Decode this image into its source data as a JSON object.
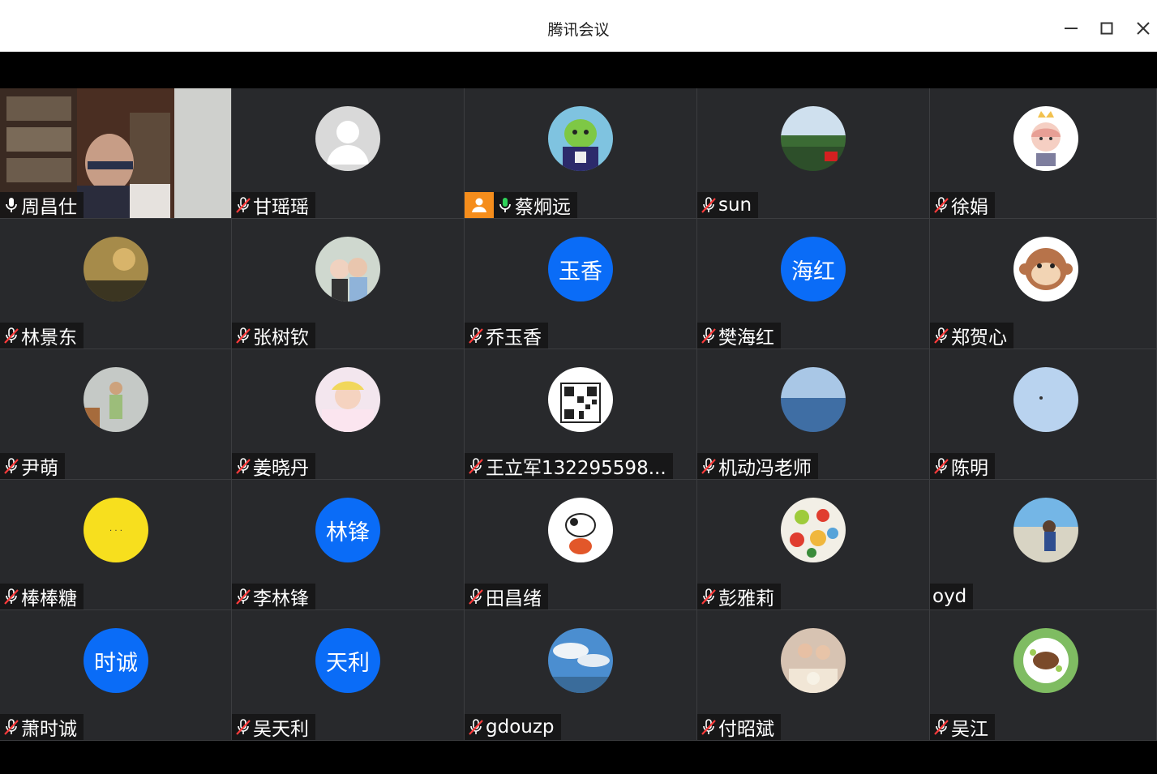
{
  "window": {
    "title": "腾讯会议",
    "buttons": {
      "minimize": "minimize",
      "maximize": "maximize",
      "close": "close"
    }
  },
  "participants": [
    {
      "name": "周昌仕",
      "mic": "on-white",
      "video": true
    },
    {
      "name": "甘瑶瑶",
      "mic": "muted",
      "avatar": "default-person"
    },
    {
      "name": "蔡炯远",
      "mic": "on-green",
      "host": true,
      "avatar": "cartoon-green-alien"
    },
    {
      "name": "sun",
      "mic": "muted",
      "avatar": "landscape-photo"
    },
    {
      "name": "徐娟",
      "mic": "muted",
      "avatar": "cartoon-girl-crown"
    },
    {
      "name": "林景东",
      "mic": "muted",
      "avatar": "sunset-photo"
    },
    {
      "name": "张树钦",
      "mic": "muted",
      "avatar": "couple-photo"
    },
    {
      "name": "乔玉香",
      "mic": "muted",
      "avatar_text": "玉香"
    },
    {
      "name": "樊海红",
      "mic": "muted",
      "avatar_text": "海红"
    },
    {
      "name": "郑贺心",
      "mic": "muted",
      "avatar": "cartoon-monkey"
    },
    {
      "name": "尹萌",
      "mic": "muted",
      "avatar": "person-photo"
    },
    {
      "name": "姜晓丹",
      "mic": "muted",
      "avatar": "baby-photo"
    },
    {
      "name": "王立军132295598...",
      "mic": "muted",
      "avatar": "qr-code"
    },
    {
      "name": "机动冯老师",
      "mic": "muted",
      "avatar": "sea-photo"
    },
    {
      "name": "陈明",
      "mic": "muted",
      "avatar": "sky-photo"
    },
    {
      "name": "棒棒糖",
      "mic": "muted",
      "avatar": "yellow-circle"
    },
    {
      "name": "李林锋",
      "mic": "muted",
      "avatar_text": "林锋"
    },
    {
      "name": "田昌绪",
      "mic": "muted",
      "avatar": "cartoon-cow"
    },
    {
      "name": "彭雅莉",
      "mic": "muted",
      "avatar": "color-dots"
    },
    {
      "name": "oyd",
      "mic": "none",
      "avatar": "beach-photo"
    },
    {
      "name": "萧时诚",
      "mic": "muted",
      "avatar_text": "时诚"
    },
    {
      "name": "吴天利",
      "mic": "muted",
      "avatar_text": "天利"
    },
    {
      "name": "gdouzp",
      "mic": "muted",
      "avatar": "clouds-photo"
    },
    {
      "name": "付昭斌",
      "mic": "muted",
      "avatar": "family-photo"
    },
    {
      "name": "吴江",
      "mic": "muted",
      "avatar": "food-photo"
    }
  ],
  "colors": {
    "tile_bg": "#28292c",
    "text_avatar_bg": "#0a6cf7",
    "host_badge": "#f58d1c",
    "mic_green": "#2fd35a",
    "mic_muted": "#ff3b3b"
  }
}
